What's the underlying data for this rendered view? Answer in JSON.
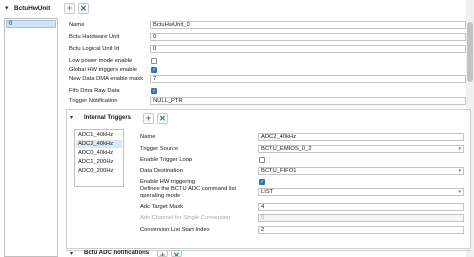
{
  "header": {
    "title": "BctuHwUnit"
  },
  "left_list": {
    "items": [
      "0"
    ]
  },
  "form": {
    "name_label": "Name",
    "name_value": "BctuHwUnit_0",
    "hw_channel_label": "Bctu Hardware Unit",
    "hw_channel_value": "0",
    "logical_id_label": "Bctu Logical Unit Id",
    "logical_id_value": "0",
    "low_power_label": "Low power mode enable",
    "global_hw_triggers_label": "Global HW triggers enable",
    "new_data_dma_label": "New Data DMA enable mask",
    "new_data_dma_value": "7",
    "fifo_dma_raw_label": "Fifo Dma Raw Data",
    "trigger_notification_label": "Trigger Notification",
    "trigger_notification_value": "NULL_PTR"
  },
  "internal_triggers": {
    "title": "Internal Triggers",
    "items": [
      "ADC1_40kHz",
      "ADC2_40kHz",
      "ADC0_40kHz",
      "ADC1_200Hz",
      "ADC0_200Hz"
    ],
    "selected_index": 1,
    "name_label": "Name",
    "name_value": "ADC2_40kHz",
    "trigger_source_label": "Trigger Source",
    "trigger_source_value": "BCTU_EMIOS_0_2",
    "enable_trigger_loop_label": "Enable Trigger Loop",
    "data_destination_label": "Data Destination",
    "data_destination_value": "BCTU_FIFO1",
    "enable_hw_triggering_label": "Enable HW triggering",
    "adc_cmd_list_label": "Defines the BCTU ADC command list operating mode",
    "adc_cmd_list_value": "LIST",
    "adc_target_mask_label": "Adc Target Mask",
    "adc_target_mask_value": "4",
    "adc_channel_label": "Adc Channel for Single Conversion",
    "adc_channel_value": "0",
    "conv_list_start_label": "Conversion List Start Index",
    "conv_list_start_value": "2"
  },
  "bottom_section": {
    "title": "Bctu ADC notifications"
  }
}
